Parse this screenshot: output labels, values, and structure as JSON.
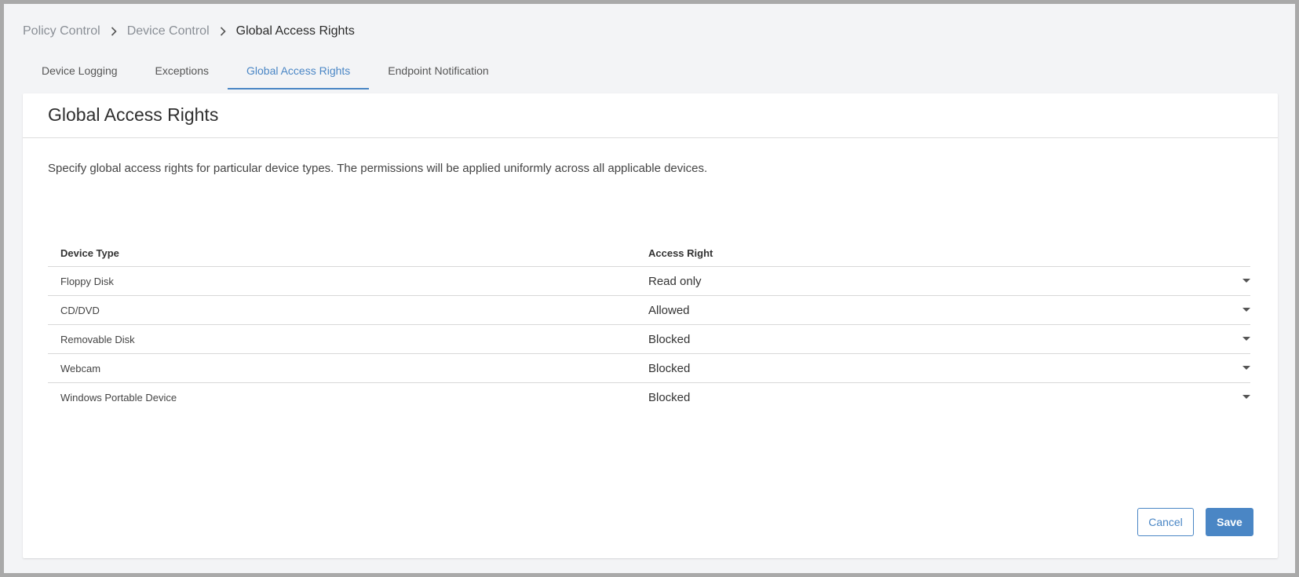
{
  "breadcrumb": {
    "items": [
      "Policy Control",
      "Device Control",
      "Global Access Rights"
    ]
  },
  "tabs": [
    {
      "label": "Device Logging",
      "active": false
    },
    {
      "label": "Exceptions",
      "active": false
    },
    {
      "label": "Global Access Rights",
      "active": true
    },
    {
      "label": "Endpoint Notification",
      "active": false
    }
  ],
  "card": {
    "title": "Global Access Rights",
    "description": "Specify global access rights for particular device types. The permissions will be applied uniformly across all applicable devices."
  },
  "table": {
    "headers": {
      "device_type": "Device Type",
      "access_right": "Access Right"
    },
    "rows": [
      {
        "device_type": "Floppy Disk",
        "access_right": "Read only"
      },
      {
        "device_type": "CD/DVD",
        "access_right": "Allowed"
      },
      {
        "device_type": "Removable Disk",
        "access_right": "Blocked"
      },
      {
        "device_type": "Webcam",
        "access_right": "Blocked"
      },
      {
        "device_type": "Windows Portable Device",
        "access_right": "Blocked"
      }
    ]
  },
  "actions": {
    "cancel_label": "Cancel",
    "save_label": "Save"
  },
  "colors": {
    "accent": "#4a86c5",
    "background": "#f3f4f6",
    "card": "#ffffff"
  },
  "icons": {
    "breadcrumb_separator": "chevron-right-icon",
    "dropdown": "caret-down-icon"
  }
}
